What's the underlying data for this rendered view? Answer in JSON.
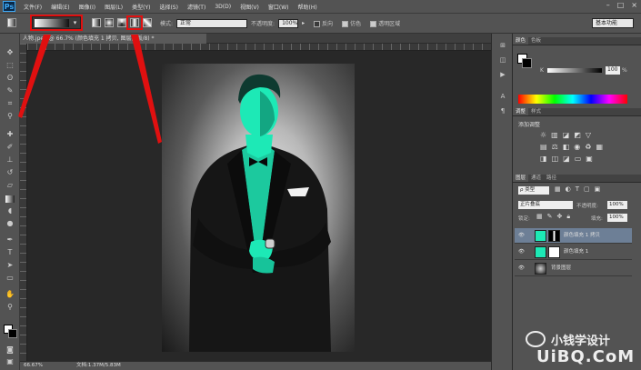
{
  "menubar": {
    "logo": "Ps",
    "items": [
      "文件(F)",
      "编辑(E)",
      "图像(I)",
      "图层(L)",
      "类型(Y)",
      "选择(S)",
      "滤镜(T)",
      "3D(D)",
      "视图(V)",
      "窗口(W)",
      "帮助(H)"
    ]
  },
  "options": {
    "mode_label": "模式:",
    "mode_value": "正常",
    "opacity_label": "不透明度:",
    "opacity_value": "100%",
    "reverse_label": "反向",
    "dither_label": "仿色",
    "transparency_label": "透明区域",
    "workspace": "基本功能"
  },
  "doc": {
    "tab_title": "人物.jpeg @ 66.7% (颜色填充 1 拷贝, 图层蒙版/8) *",
    "zoom": "66.67%",
    "doc_size": "文档:1.37M/5.83M"
  },
  "panels": {
    "color_tabs": [
      "颜色",
      "色板"
    ],
    "k_label": "K",
    "k_value": "100",
    "k_unit": "%",
    "adj_tabs": [
      "调整",
      "样式"
    ],
    "adj_title": "添加调整",
    "layers_tabs": [
      "图层",
      "通道",
      "路径"
    ],
    "filter_kind": "ρ 类型",
    "blend_mode": "正片叠底",
    "opacity_label": "不透明度:",
    "opacity_value": "100%",
    "lock_label": "锁定:",
    "fill_label": "填充:",
    "fill_value": "100%",
    "layers": [
      {
        "name": "颜色填充 1 拷贝"
      },
      {
        "name": "颜色填充 1"
      },
      {
        "name": "背景图层"
      }
    ]
  },
  "watermark": {
    "text": "小钱学设计",
    "site": "UiBQ.CoM"
  },
  "colors": {
    "highlight": "#e01010",
    "fill_cyan": "#1de9b6",
    "ui_panel": "#535353",
    "canvas_bg": "#282828"
  },
  "icons": {
    "move": "move-icon",
    "marquee": "marquee-icon",
    "lasso": "lasso-icon",
    "brush": "brush-icon",
    "gradient": "gradient-icon",
    "pen": "pen-icon",
    "type": "type-icon",
    "hand": "hand-icon",
    "zoom": "zoom-icon",
    "eye": "eye-icon"
  }
}
